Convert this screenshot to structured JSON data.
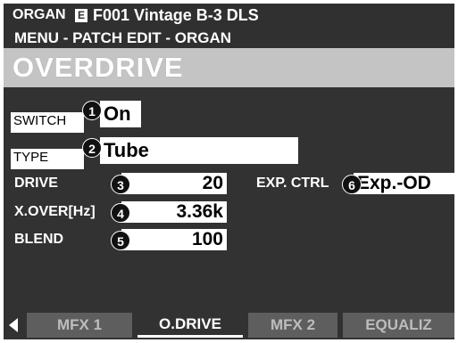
{
  "header": {
    "section": "ORGAN",
    "section_badge": "E",
    "patch": "F001 Vintage B-3 DLS",
    "path": "MENU - PATCH EDIT - ORGAN"
  },
  "page": {
    "title": "OVERDRIVE"
  },
  "params": {
    "switch": {
      "label": "SWITCH",
      "value": "On",
      "num": "1"
    },
    "type": {
      "label": "TYPE",
      "value": "Tube",
      "num": "2"
    },
    "drive": {
      "label": "DRIVE",
      "value": "20",
      "num": "3"
    },
    "xover": {
      "label": "X.OVER[Hz]",
      "value": "3.36k",
      "num": "4"
    },
    "blend": {
      "label": "BLEND",
      "value": "100",
      "num": "5"
    },
    "exp_ctrl": {
      "label": "EXP. CTRL",
      "value": "Exp.-OD",
      "num": "6"
    }
  },
  "tabs": [
    {
      "label": "MFX 1"
    },
    {
      "label": "O.DRIVE"
    },
    {
      "label": "MFX 2"
    },
    {
      "label": "EQUALIZ"
    }
  ],
  "colors": {
    "screen_bg": "#323232",
    "title_bar": "#c4c4c4",
    "tab_inactive": "#5e5e5e",
    "text": "#ffffff"
  },
  "icons": {
    "prev_tab": "left-triangle-icon"
  }
}
